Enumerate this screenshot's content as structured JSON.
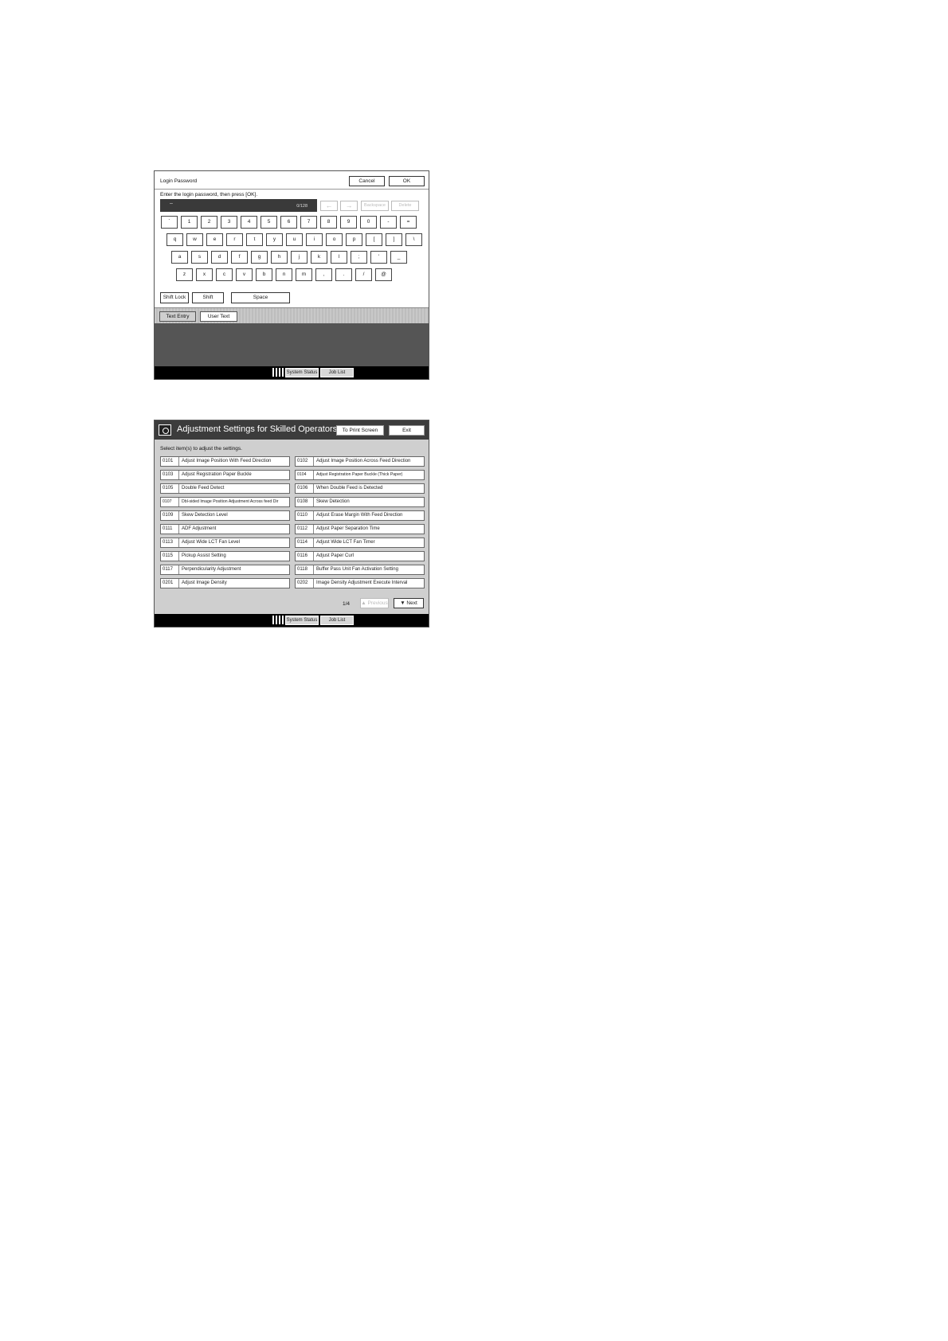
{
  "login_screen": {
    "title": "Login Password",
    "cancel_label": "Cancel",
    "ok_label": "OK",
    "instruction": "Enter the login password, then press [OK].",
    "input_value": "–",
    "char_count": "0/128",
    "left_arrow": "←",
    "right_arrow": "→",
    "backspace_label": "Backspace",
    "delete_label": "Delete",
    "key_rows": [
      [
        "`",
        "1",
        "2",
        "3",
        "4",
        "5",
        "6",
        "7",
        "8",
        "9",
        "0",
        "-",
        "="
      ],
      [
        "q",
        "w",
        "e",
        "r",
        "t",
        "y",
        "u",
        "i",
        "o",
        "p",
        "[",
        "]",
        "\\"
      ],
      [
        "a",
        "s",
        "d",
        "f",
        "g",
        "h",
        "j",
        "k",
        "l",
        ";",
        "'",
        "_"
      ],
      [
        "z",
        "x",
        "c",
        "v",
        "b",
        "n",
        "m",
        ",",
        ".",
        "/",
        "@"
      ]
    ],
    "shift_lock_label": "Shift Lock",
    "shift_label": "Shift",
    "space_label": "Space",
    "tabs": [
      "Text Entry",
      "User Text"
    ],
    "status_buttons": [
      "System Status",
      "Job List"
    ]
  },
  "adjust_screen": {
    "title": "Adjustment Settings for Skilled Operators",
    "print_screen_label": "To Print Screen",
    "exit_label": "Exit",
    "instruction": "Select item(s) to adjust the settings.",
    "left_items": [
      {
        "code": "0101",
        "label": "Adjust Image Position With Feed Direction"
      },
      {
        "code": "0103",
        "label": "Adjust Registration Paper Buckle"
      },
      {
        "code": "0105",
        "label": "Double Feed Detect"
      },
      {
        "code": "0107",
        "label": "Dbl-sided Image Position Adjustment Across feed Dir"
      },
      {
        "code": "0109",
        "label": "Skew Detection Level"
      },
      {
        "code": "0111",
        "label": "ADF Adjustment"
      },
      {
        "code": "0113",
        "label": "Adjust Wide LCT Fan Level"
      },
      {
        "code": "0115",
        "label": "Pickup Assist Setting"
      },
      {
        "code": "0117",
        "label": "Perpendicularity Adjustment"
      },
      {
        "code": "0201",
        "label": "Adjust Image Density"
      }
    ],
    "right_items": [
      {
        "code": "0102",
        "label": "Adjust Image Position Across Feed Direction"
      },
      {
        "code": "0104",
        "label": "Adjust Registration Paper Buckle (Thick Paper)"
      },
      {
        "code": "0106",
        "label": "When Double Feed is Detected"
      },
      {
        "code": "0108",
        "label": "Skew Detection"
      },
      {
        "code": "0110",
        "label": "Adjust Erase Margin With Feed Direction"
      },
      {
        "code": "0112",
        "label": "Adjust Paper Separation Time"
      },
      {
        "code": "0114",
        "label": "Adjust Wide LCT Fan Timer"
      },
      {
        "code": "0116",
        "label": "Adjust Paper Curl"
      },
      {
        "code": "0118",
        "label": "Buffer Pass Unit Fan Activation Setting"
      },
      {
        "code": "0202",
        "label": "Image Density Adjustment Execute Interval"
      }
    ],
    "page_indicator": "1/4",
    "previous_label": "▲ Previous",
    "next_label": "▼ Next",
    "status_buttons": [
      "System Status",
      "Job List"
    ]
  }
}
